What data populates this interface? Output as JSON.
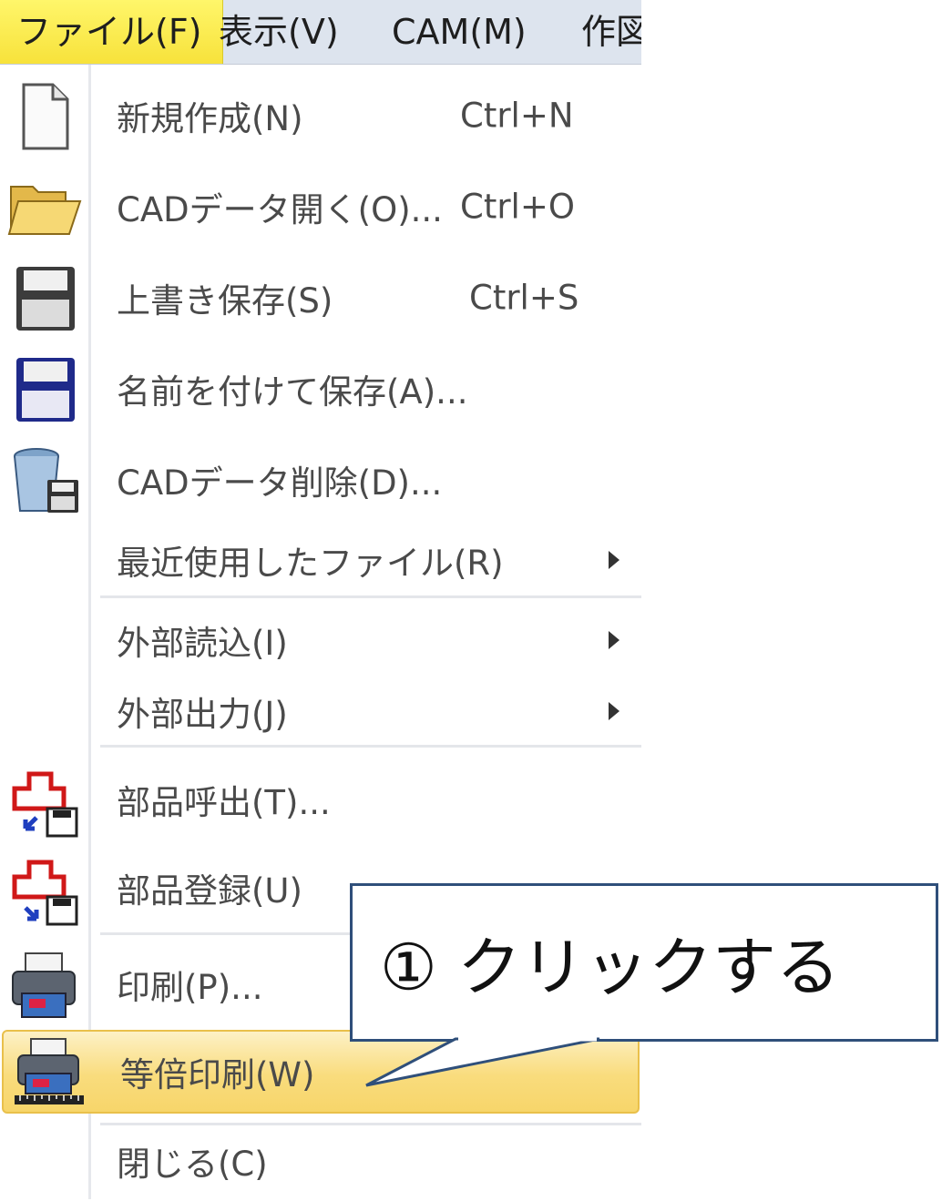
{
  "menubar": {
    "items": [
      {
        "label": "ファイル(F)",
        "active": true
      },
      {
        "label": "表示(V)"
      },
      {
        "label": "CAM(M)"
      },
      {
        "label": "作図"
      }
    ]
  },
  "file_menu": {
    "items": [
      {
        "label": "新規作成(N)",
        "shortcut": "Ctrl+N",
        "icon": "new-document-icon"
      },
      {
        "label": "CADデータ開く(O)...",
        "shortcut": "Ctrl+O",
        "icon": "open-folder-icon"
      },
      {
        "label": "上書き保存(S)",
        "shortcut": "Ctrl+S",
        "icon": "save-icon"
      },
      {
        "label": "名前を付けて保存(A)...",
        "icon": "save-as-icon"
      },
      {
        "label": "CADデータ削除(D)...",
        "icon": "delete-cad-data-icon"
      },
      {
        "label": "最近使用したファイル(R)",
        "submenu": true
      },
      {
        "label": "外部読込(I)",
        "submenu": true
      },
      {
        "label": "外部出力(J)",
        "submenu": true
      },
      {
        "label": "部品呼出(T)...",
        "icon": "part-call-icon"
      },
      {
        "label": "部品登録(U)",
        "icon": "part-register-icon"
      },
      {
        "label": "印刷(P)...",
        "icon": "printer-icon"
      },
      {
        "label": "等倍印刷(W)",
        "icon": "actual-size-print-icon",
        "highlighted": true
      },
      {
        "label": "閉じる(C)"
      }
    ]
  },
  "callout": {
    "text": "① クリックする"
  },
  "colors": {
    "menubar_bg": "#dde4ee",
    "active_menu": "#f7e23b",
    "highlight": "#f9dc7d",
    "callout_border": "#2f4f7a"
  }
}
